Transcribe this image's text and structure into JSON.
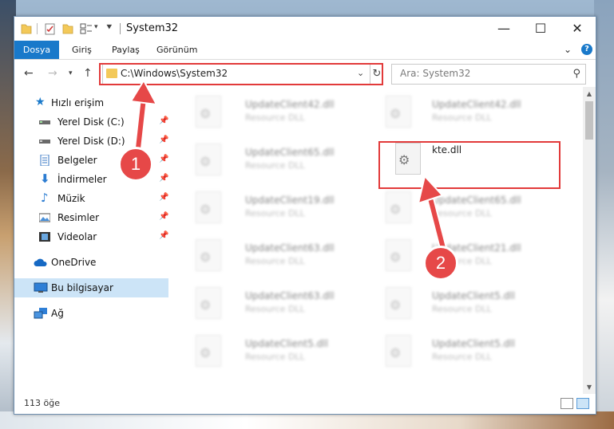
{
  "window": {
    "title": "System32",
    "controls": {
      "minimize": "—",
      "maximize": "☐",
      "close": "✕"
    }
  },
  "ribbon": {
    "tabs": [
      "Dosya",
      "Giriş",
      "Paylaş",
      "Görünüm"
    ],
    "help": "?"
  },
  "nav": {
    "address": "C:\\Windows\\System32",
    "search_placeholder": "Ara: System32"
  },
  "sidebar": {
    "items": [
      {
        "label": "Hızlı erişim",
        "icon": "star-icon"
      },
      {
        "label": "Yerel Disk (C:)",
        "icon": "drive-icon",
        "pinned": true
      },
      {
        "label": "Yerel Disk (D:)",
        "icon": "drive-icon",
        "pinned": true
      },
      {
        "label": "Belgeler",
        "icon": "documents-icon",
        "pinned": true
      },
      {
        "label": "İndirmeler",
        "icon": "download-icon",
        "pinned": true
      },
      {
        "label": "Müzik",
        "icon": "music-icon",
        "pinned": true
      },
      {
        "label": "Resimler",
        "icon": "pictures-icon",
        "pinned": true
      },
      {
        "label": "Videolar",
        "icon": "video-icon",
        "pinned": true
      },
      {
        "label": "OneDrive",
        "icon": "cloud-icon"
      },
      {
        "label": "Bu bilgisayar",
        "icon": "computer-icon",
        "selected": true
      },
      {
        "label": "Ağ",
        "icon": "network-icon"
      }
    ]
  },
  "files": {
    "left": [
      {
        "name": "UpdateClient42.dll",
        "type": "Resource DLL"
      },
      {
        "name": "UpdateClient65.dll",
        "type": "Resource DLL"
      },
      {
        "name": "UpdateClient19.dll",
        "type": "Resource DLL"
      },
      {
        "name": "UpdateClient63.dll",
        "type": "Resource DLL"
      },
      {
        "name": "UpdateClient63.dll",
        "type": "Resource DLL"
      },
      {
        "name": "UpdateClient5.dll",
        "type": "Resource DLL"
      }
    ],
    "right": [
      {
        "name": "UpdateClient42.dll",
        "type": "Resource DLL"
      },
      {
        "name": "kte.dll",
        "type": "",
        "highlighted": true
      },
      {
        "name": "UpdateClient65.dll",
        "type": "Resource DLL"
      },
      {
        "name": "UpdateClient21.dll",
        "type": "Resource DLL"
      },
      {
        "name": "UpdateClient5.dll",
        "type": "Resource DLL"
      },
      {
        "name": "UpdateClient5.dll",
        "type": "Resource DLL"
      }
    ]
  },
  "status": {
    "count": "113 öğe"
  },
  "annotations": {
    "step1": "1",
    "step2": "2",
    "color": "#e64848"
  }
}
